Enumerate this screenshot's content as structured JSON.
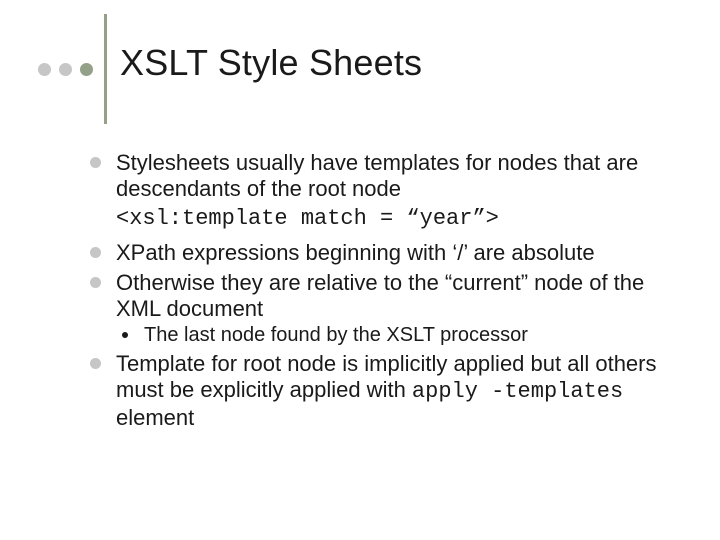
{
  "title": "XSLT Style Sheets",
  "bullets": {
    "b1": "Stylesheets usually have templates for nodes that are descendants of the root node",
    "b1_code": "<xsl:template match = “year”>",
    "b2": "XPath expressions beginning with ‘/’ are absolute",
    "b3": "Otherwise they are relative to the “current” node of the XML document",
    "b3_sub": "The last node found by the XSLT processor",
    "b4_pre": "Template for root node is implicitly applied but all others must be explicitly applied with ",
    "b4_code": "apply -templates",
    "b4_post": " element"
  }
}
